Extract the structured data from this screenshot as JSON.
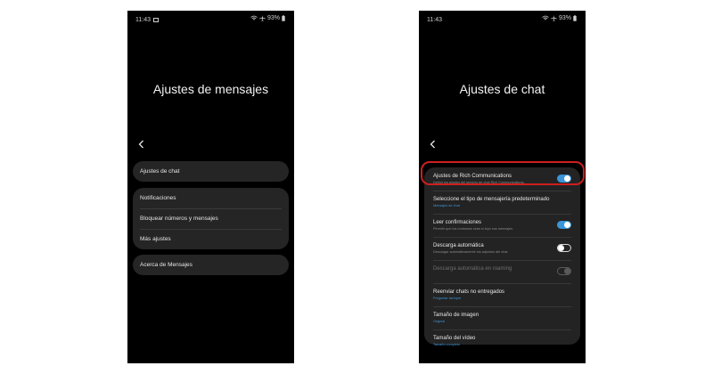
{
  "left_phone": {
    "status": {
      "time": "11:43",
      "battery": "93%"
    },
    "title": "Ajustes de mensajes",
    "groups": [
      {
        "items": [
          {
            "label": "Ajustes de chat"
          }
        ]
      },
      {
        "items": [
          {
            "label": "Notificaciones"
          },
          {
            "label": "Bloquear números y mensajes"
          },
          {
            "label": "Más ajustes"
          }
        ]
      },
      {
        "items": [
          {
            "label": "Acerca de Mensajes"
          }
        ]
      }
    ]
  },
  "right_phone": {
    "status": {
      "time": "11:43",
      "battery": "93%"
    },
    "title": "Ajustes de chat",
    "items": [
      {
        "title": "Ajustes de Rich Communications",
        "subtitle": "Definir los ajustes del servicio de chat Rich Communications.",
        "toggle": "on",
        "highlighted": true
      },
      {
        "title": "Seleccione el tipo de mensajería predeterminado",
        "subtitle": "Mensajes de chat",
        "subtitle_color": "blue"
      },
      {
        "title": "Leer confirmaciones",
        "subtitle": "Permitir que los contactos vean si leyó sus mensajes.",
        "toggle": "on"
      },
      {
        "title": "Descarga automática",
        "subtitle": "Descargar automáticamente los adjuntos del chat.",
        "toggle": "off"
      },
      {
        "title": "Descarga automática en roaming",
        "toggle": "disabled",
        "disabled": true
      },
      {
        "title": "Reenviar chats no entregados",
        "subtitle": "Preguntar siempre",
        "subtitle_color": "blue"
      },
      {
        "title": "Tamaño de imagen",
        "subtitle": "Original",
        "subtitle_color": "blue"
      },
      {
        "title": "Tamaño del vídeo",
        "subtitle": "Tamaño completo",
        "subtitle_color": "blue"
      }
    ]
  },
  "colors": {
    "accent": "#3b95d8",
    "highlight": "#cc1f1f",
    "background": "#000000",
    "card": "#242424"
  },
  "icons": [
    "gallery-icon",
    "wifi-icon",
    "airplane-icon",
    "battery-icon",
    "back-arrow-icon"
  ]
}
